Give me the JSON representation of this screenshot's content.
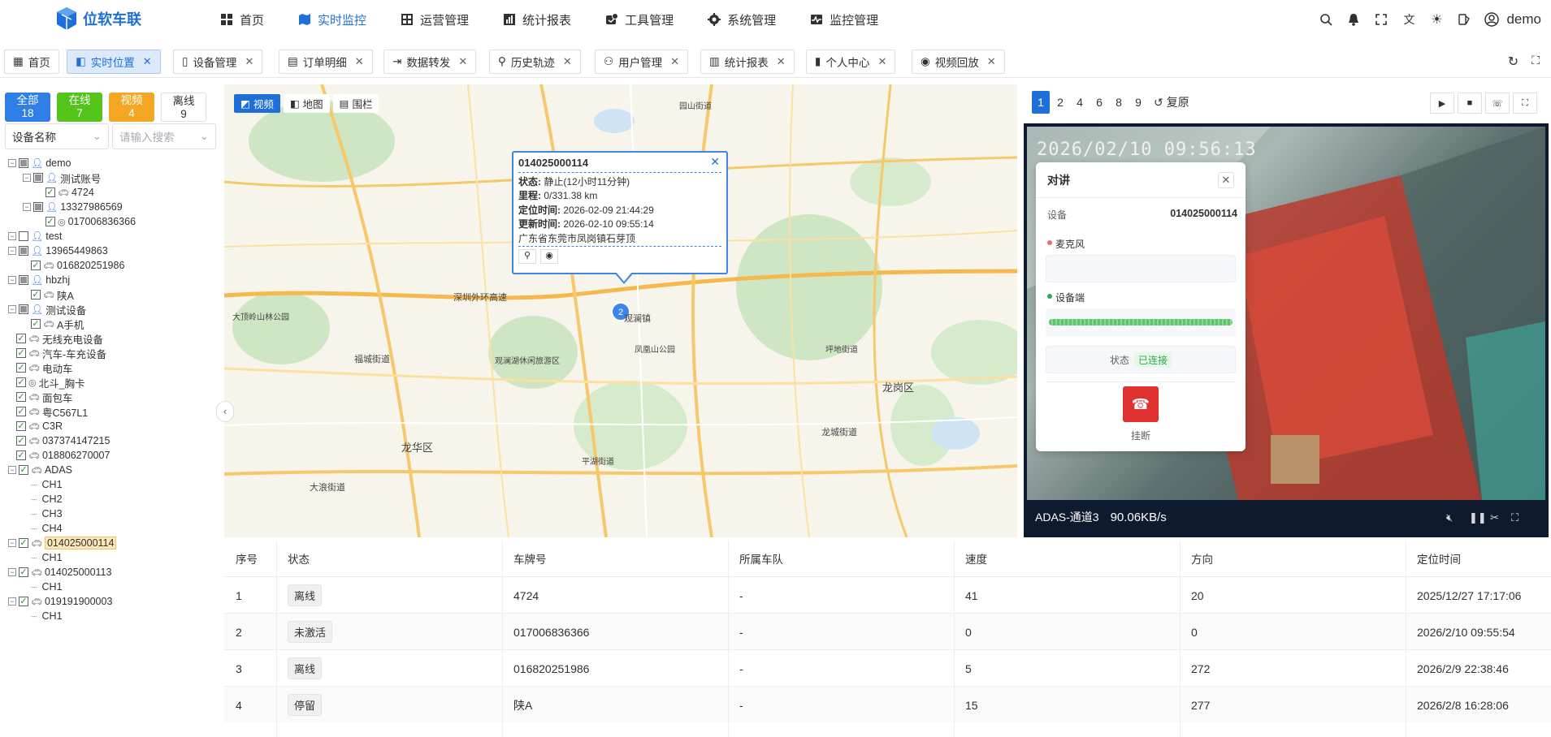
{
  "app": {
    "title": "位软车联",
    "user": "demo"
  },
  "nav": [
    {
      "label": "首页",
      "icon": "dashboard-icon"
    },
    {
      "label": "实时监控",
      "icon": "map-icon",
      "active": true
    },
    {
      "label": "运营管理",
      "icon": "grid-icon"
    },
    {
      "label": "统计报表",
      "icon": "report-icon"
    },
    {
      "label": "工具管理",
      "icon": "tool-icon"
    },
    {
      "label": "系统管理",
      "icon": "gear-icon"
    },
    {
      "label": "监控管理",
      "icon": "monitor-icon"
    }
  ],
  "tabs": [
    {
      "label": "首页",
      "closable": false
    },
    {
      "label": "实时位置",
      "closable": true,
      "active": true
    },
    {
      "label": "设备管理",
      "closable": true
    },
    {
      "label": "订单明细",
      "closable": true
    },
    {
      "label": "数据转发",
      "closable": true
    },
    {
      "label": "历史轨迹",
      "closable": true
    },
    {
      "label": "用户管理",
      "closable": true
    },
    {
      "label": "统计报表",
      "closable": true
    },
    {
      "label": "个人中心",
      "closable": true
    },
    {
      "label": "视频回放",
      "closable": true
    }
  ],
  "stats": [
    {
      "label": "全部",
      "count": "18",
      "color": "#2f7fe6"
    },
    {
      "label": "在线",
      "count": "7",
      "color": "#52c41a"
    },
    {
      "label": "视频",
      "count": "4",
      "color": "#f5a623"
    },
    {
      "label": "离线",
      "count": "9",
      "color": ""
    }
  ],
  "filter": {
    "field": "设备名称",
    "search_placeholder": "请输入搜索"
  },
  "tree": [
    {
      "label": "demo",
      "type": "user",
      "level": 0,
      "check": "half"
    },
    {
      "label": "测试账号",
      "type": "user",
      "level": 1,
      "check": "half"
    },
    {
      "label": "4724",
      "type": "car",
      "level": 2,
      "check": "on"
    },
    {
      "label": "13327986569",
      "type": "user",
      "level": 1,
      "check": "half"
    },
    {
      "label": "017006836366",
      "type": "dot",
      "level": 2,
      "check": "on"
    },
    {
      "label": "test",
      "type": "user",
      "level": 0,
      "check": "off"
    },
    {
      "label": "13965449863",
      "type": "user",
      "level": 0,
      "check": "half"
    },
    {
      "label": "016820251986",
      "type": "car",
      "level": 1,
      "check": "on"
    },
    {
      "label": "hbzhj",
      "type": "user",
      "level": 0,
      "check": "half"
    },
    {
      "label": "陕A",
      "type": "car",
      "level": 1,
      "check": "on"
    },
    {
      "label": "测试设备",
      "type": "user",
      "level": 0,
      "check": "half"
    },
    {
      "label": "A手机",
      "type": "car",
      "level": 1,
      "check": "on"
    },
    {
      "label": "无线充电设备",
      "type": "car",
      "level": 0,
      "check": "on"
    },
    {
      "label": "汽车-车充设备",
      "type": "car",
      "level": 0,
      "check": "on"
    },
    {
      "label": "电动车",
      "type": "car",
      "level": 0,
      "check": "on"
    },
    {
      "label": "北斗_胸卡",
      "type": "dot",
      "level": 0,
      "check": "on"
    },
    {
      "label": "面包车",
      "type": "car",
      "level": 0,
      "check": "on"
    },
    {
      "label": "粤C567L1",
      "type": "car",
      "level": 0,
      "check": "on"
    },
    {
      "label": "C3R",
      "type": "car",
      "level": 0,
      "check": "on"
    },
    {
      "label": "037374147215",
      "type": "car",
      "level": 0,
      "check": "on"
    },
    {
      "label": "018806270007",
      "type": "car",
      "level": 0,
      "check": "on"
    },
    {
      "label": "ADAS",
      "type": "car",
      "level": 0,
      "check": "on"
    },
    {
      "label": "CH1",
      "type": "ch",
      "level": 1,
      "check": "none"
    },
    {
      "label": "CH2",
      "type": "ch",
      "level": 1,
      "check": "none"
    },
    {
      "label": "CH3",
      "type": "ch",
      "level": 1,
      "check": "none"
    },
    {
      "label": "CH4",
      "type": "ch",
      "level": 1,
      "check": "none"
    },
    {
      "label": "014025000114",
      "type": "car",
      "level": 0,
      "check": "on",
      "highlight": true
    },
    {
      "label": "CH1",
      "type": "ch",
      "level": 1,
      "check": "none"
    },
    {
      "label": "014025000113",
      "type": "car",
      "level": 0,
      "check": "on"
    },
    {
      "label": "CH1",
      "type": "ch",
      "level": 1,
      "check": "none"
    },
    {
      "label": "019191900003",
      "type": "car",
      "level": 0,
      "check": "on"
    },
    {
      "label": "CH1",
      "type": "ch",
      "level": 1,
      "check": "none"
    }
  ],
  "map": {
    "toolbar": [
      {
        "label": "视频",
        "active": true
      },
      {
        "label": "地图"
      },
      {
        "label": "围栏"
      }
    ],
    "cluster_count": "2",
    "district_labels": [
      "龙华区",
      "龙岗区",
      "深圳外环高速",
      "福城街道",
      "观澜镇",
      "大浪街道",
      "平湖街道",
      "龙城街道",
      "凤凰山公园",
      "观澜湖休闲旅游区",
      "大顶岭山林公园",
      "园山街道",
      "坪地街道"
    ],
    "popup": {
      "title": "014025000114",
      "status_label": "状态:",
      "status": "静止(12小时11分钟)",
      "mileage_label": "里程:",
      "mileage": "0/331.38 km",
      "locate_label": "定位时间:",
      "locate_time": "2026-02-09 21:44:29",
      "update_label": "更新时间:",
      "update_time": "2026-02-10 09:55:14",
      "address": "广东省东莞市凤岗镇石芽顶"
    }
  },
  "video": {
    "screens": [
      "1",
      "2",
      "4",
      "6",
      "8",
      "9"
    ],
    "active_screen": "1",
    "reset_label": "复原",
    "timestamp": "2026/02/10 09:56:13",
    "channel": "ADAS-通道3",
    "speed": "90.06KB/s"
  },
  "talk": {
    "title": "对讲",
    "device_label": "设备",
    "device": "014025000114",
    "mic_label": "麦克风",
    "device_side_label": "设备端",
    "status_label": "状态",
    "status": "已连接",
    "hangup_label": "挂断"
  },
  "table": {
    "columns": [
      "序号",
      "状态",
      "车牌号",
      "所属车队",
      "速度",
      "方向",
      "定位时间"
    ],
    "rows": [
      [
        "1",
        "离线",
        "4724",
        "-",
        "41",
        "20",
        "2025/12/27 17:17:06"
      ],
      [
        "2",
        "未激活",
        "017006836366",
        "-",
        "0",
        "0",
        "2026/2/10 09:55:54"
      ],
      [
        "3",
        "离线",
        "016820251986",
        "-",
        "5",
        "272",
        "2026/2/9 22:38:46"
      ],
      [
        "4",
        "停留",
        "陕A",
        "-",
        "15",
        "277",
        "2026/2/8 16:28:06"
      ]
    ]
  },
  "colors": {
    "accent": "#1e6fd9",
    "danger": "#e03131",
    "success": "#2eaa4f"
  }
}
